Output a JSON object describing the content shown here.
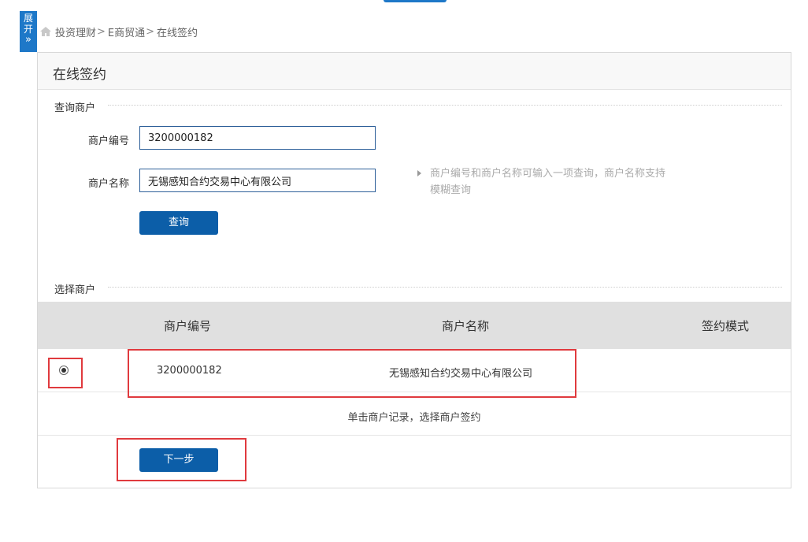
{
  "expand_tab": {
    "label_line1": "展",
    "label_line2": "开",
    "arrow": "»"
  },
  "breadcrumb": {
    "item1": "投资理财",
    "item2": "E商贸通",
    "item3": "在线签约",
    "separator": ">"
  },
  "panel": {
    "title": "在线签约"
  },
  "query_section": {
    "label": "查询商户",
    "merchant_id_label": "商户编号",
    "merchant_id_value": "3200000182",
    "merchant_name_label": "商户名称",
    "merchant_name_value": "无锡感知合约交易中心有限公司",
    "hint": "商户编号和商户名称可输入一项查询，商户名称支持模糊查询",
    "query_button": "查询"
  },
  "select_section": {
    "label": "选择商户",
    "columns": [
      "商户编号",
      "商户名称",
      "签约模式"
    ],
    "rows": [
      {
        "selected": true,
        "merchant_id": "3200000182",
        "merchant_name": "无锡感知合约交易中心有限公司",
        "mode": ""
      }
    ],
    "note": "单击商户记录，选择商户签约",
    "next_button": "下一步"
  },
  "colors": {
    "accent": "#0c5ea8",
    "highlight": "#e03a3e",
    "table_header_bg": "#e0e0e0"
  }
}
